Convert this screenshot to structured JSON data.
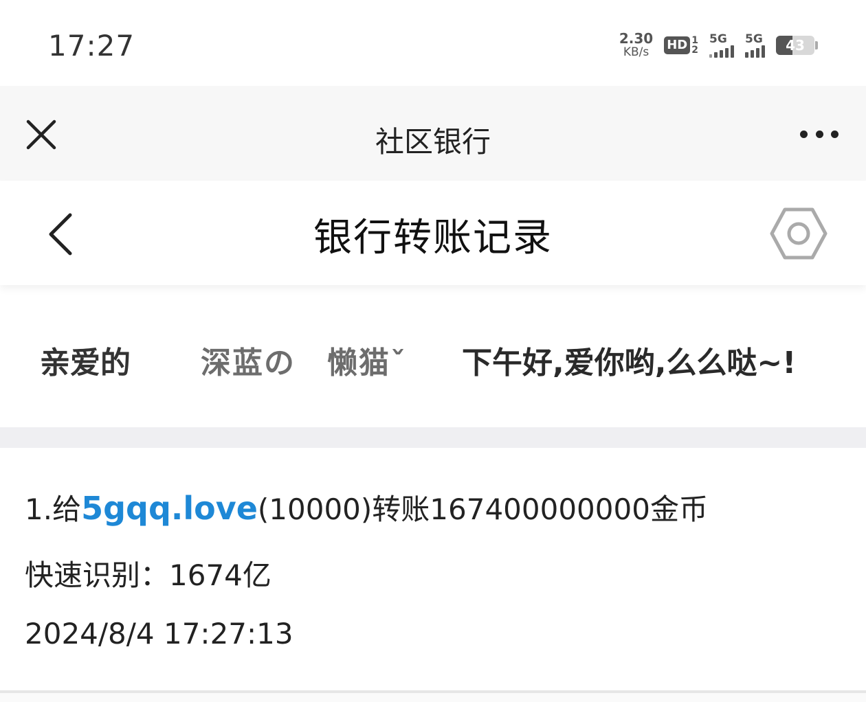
{
  "status_bar": {
    "time": "17:27",
    "net_speed_value": "2.30",
    "net_speed_unit": "KB/s",
    "hd_label": "HD",
    "hd_sim_top": "1",
    "hd_sim_bottom": "2",
    "signal1_label": "5G",
    "signal2_label": "5G",
    "battery_level": "43"
  },
  "top_nav": {
    "title": "社区银行",
    "close_icon": "close-icon",
    "more_icon": "more-dots-icon"
  },
  "page_header": {
    "title": "银行转账记录",
    "back_icon": "chevron-left-icon",
    "settings_icon": "hexagon-settings-icon"
  },
  "greeting": {
    "salutation": "亲爱的",
    "name": "深蓝の　懒猫ˇ",
    "message": "下午好,爱你哟,么么哒~!"
  },
  "record": {
    "prefix": "1.给",
    "recipient": "5gqq.love",
    "detail": "(10000)转账167400000000金币",
    "quick_label": "快速识别：",
    "quick_value": "1674亿",
    "timestamp": "2024/8/4 17:27:13"
  },
  "colors": {
    "accent_link": "#1e88d6",
    "nav_bg": "#f7f7f7",
    "divider_band": "#efeff2"
  }
}
